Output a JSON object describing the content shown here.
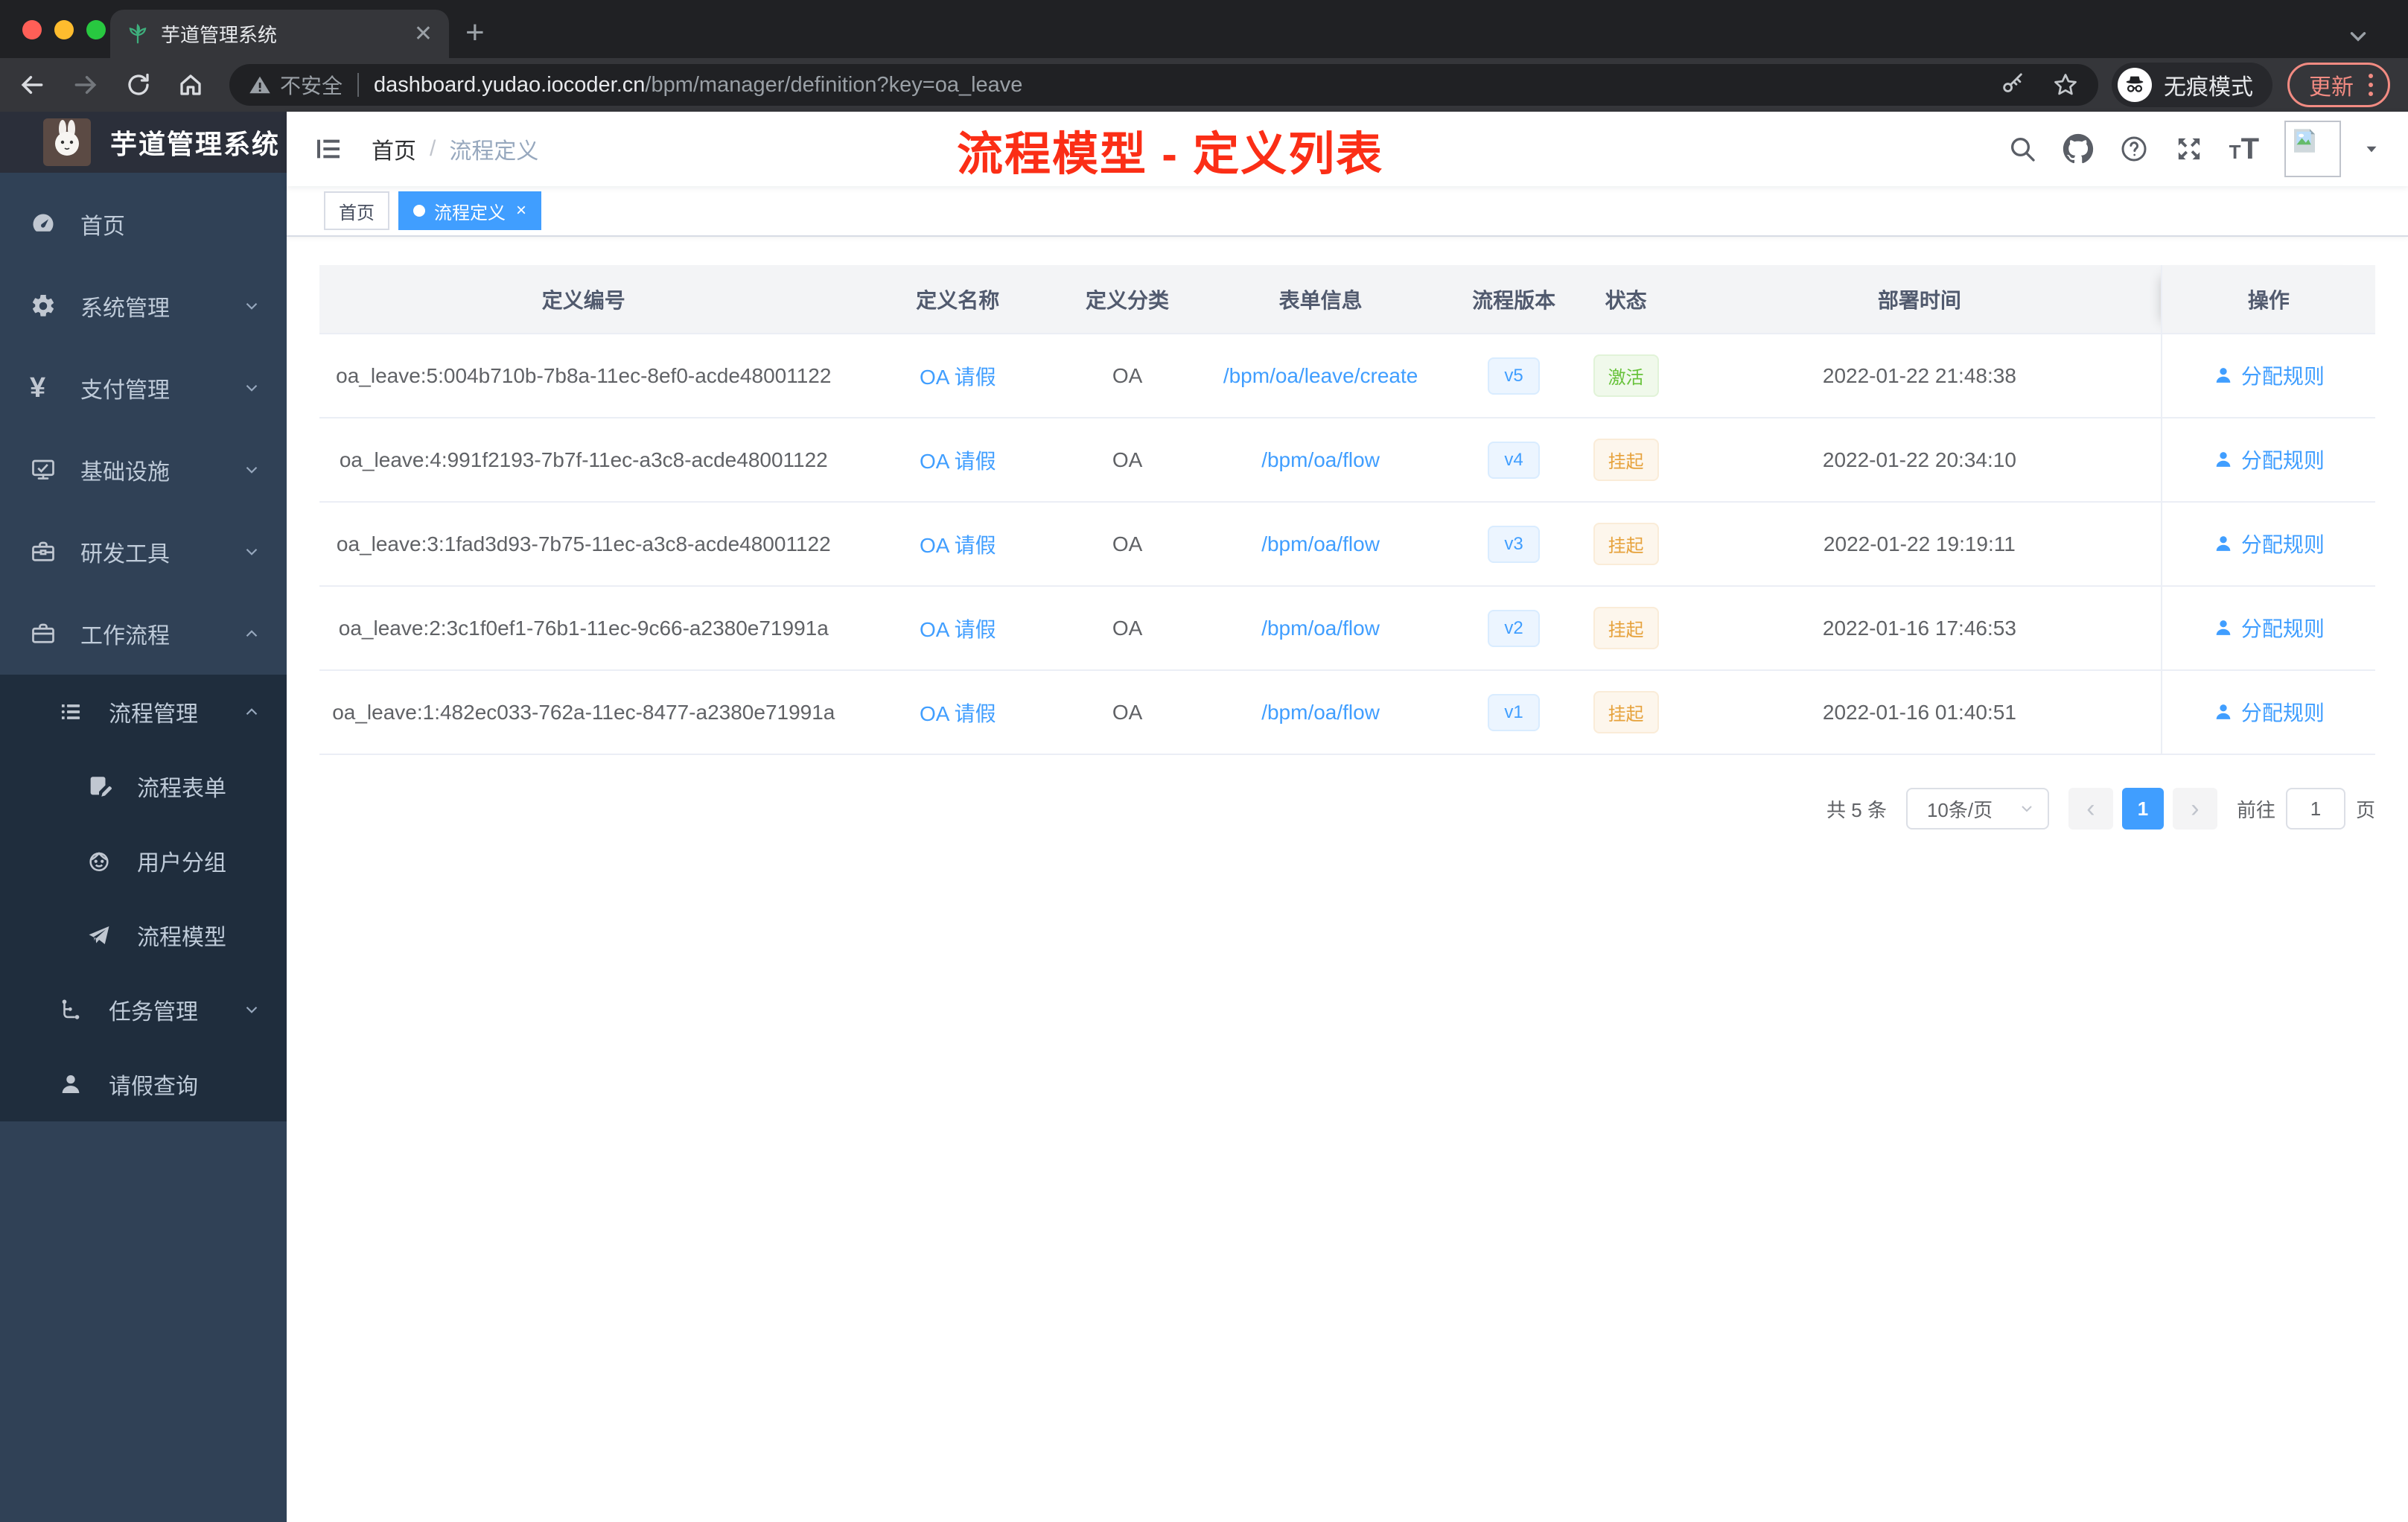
{
  "browser": {
    "tab_title": "芋道管理系统",
    "address": {
      "security_label": "不安全",
      "domain": "dashboard.yudao.iocoder.cn",
      "path": "/bpm/manager/definition?key=oa_leave"
    },
    "incognito_label": "无痕模式",
    "update_label": "更新"
  },
  "annotation": "流程模型 - 定义列表",
  "sidebar": {
    "logo_title": "芋道管理系统",
    "menu": [
      {
        "label": "首页",
        "icon": "dashboard-icon"
      },
      {
        "label": "系统管理",
        "icon": "gear-icon"
      },
      {
        "label": "支付管理",
        "icon": "yen-icon"
      },
      {
        "label": "基础设施",
        "icon": "monitor-icon"
      },
      {
        "label": "研发工具",
        "icon": "toolbox-icon"
      },
      {
        "label": "工作流程",
        "icon": "briefcase-icon"
      }
    ],
    "submenu": [
      {
        "label": "流程管理",
        "icon": "list-icon"
      },
      {
        "label": "流程表单",
        "icon": "form-icon"
      },
      {
        "label": "用户分组",
        "icon": "face-icon"
      },
      {
        "label": "流程模型",
        "icon": "send-icon"
      },
      {
        "label": "任务管理",
        "icon": "tree-icon"
      },
      {
        "label": "请假查询",
        "icon": "person-icon"
      }
    ]
  },
  "header": {
    "breadcrumb": {
      "home": "首页",
      "separator": "/",
      "current": "流程定义"
    }
  },
  "tags": {
    "home": "首页",
    "active": "流程定义",
    "close": "×"
  },
  "table": {
    "headers": [
      "定义编号",
      "定义名称",
      "定义分类",
      "表单信息",
      "流程版本",
      "状态",
      "部署时间",
      "操作"
    ],
    "action_label": "分配规则",
    "rows": [
      {
        "id": "oa_leave:5:004b710b-7b8a-11ec-8ef0-acde48001122",
        "name": "OA 请假",
        "category": "OA",
        "form": "/bpm/oa/leave/create",
        "version": "v5",
        "status": "激活",
        "time": "2022-01-22 21:48:38"
      },
      {
        "id": "oa_leave:4:991f2193-7b7f-11ec-a3c8-acde48001122",
        "name": "OA 请假",
        "category": "OA",
        "form": "/bpm/oa/flow",
        "version": "v4",
        "status": "挂起",
        "time": "2022-01-22 20:34:10"
      },
      {
        "id": "oa_leave:3:1fad3d93-7b75-11ec-a3c8-acde48001122",
        "name": "OA 请假",
        "category": "OA",
        "form": "/bpm/oa/flow",
        "version": "v3",
        "status": "挂起",
        "time": "2022-01-22 19:19:11"
      },
      {
        "id": "oa_leave:2:3c1f0ef1-76b1-11ec-9c66-a2380e71991a",
        "name": "OA 请假",
        "category": "OA",
        "form": "/bpm/oa/flow",
        "version": "v2",
        "status": "挂起",
        "time": "2022-01-16 17:46:53"
      },
      {
        "id": "oa_leave:1:482ec033-762a-11ec-8477-a2380e71991a",
        "name": "OA 请假",
        "category": "OA",
        "form": "/bpm/oa/flow",
        "version": "v1",
        "status": "挂起",
        "time": "2022-01-16 01:40:51"
      }
    ]
  },
  "pagination": {
    "total": "共 5 条",
    "page_size": "10条/页",
    "prev": "‹",
    "current_page": "1",
    "next": "›",
    "goto_label": "前往",
    "goto_value": "1",
    "page_unit": "页"
  },
  "colors": {
    "accent": "#409eff",
    "status_active": "#67c23a",
    "status_suspended": "#e6a23c",
    "annotation_red": "#fb2e16",
    "sidebar_bg": "#304156",
    "submenu_bg": "#1f2d3d"
  }
}
